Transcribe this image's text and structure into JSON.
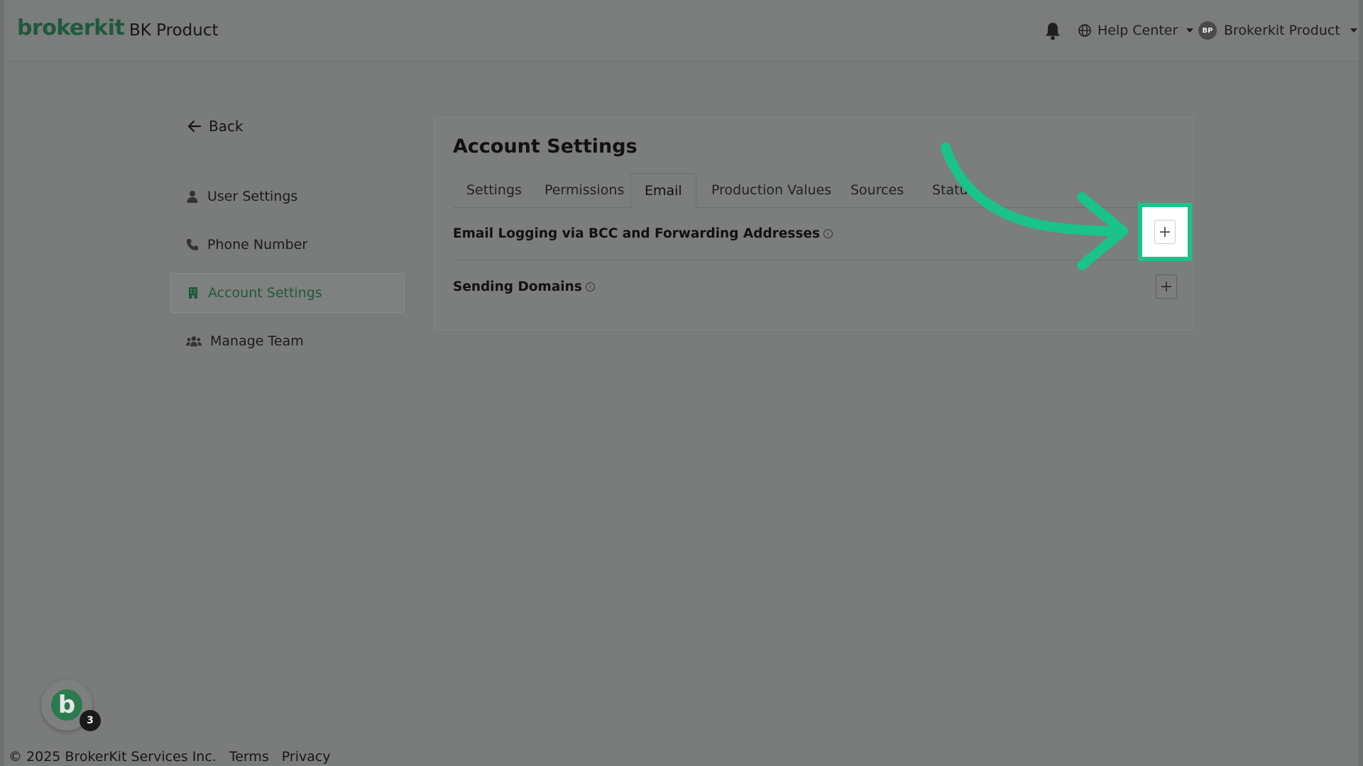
{
  "header": {
    "logo": "brokerkit",
    "product_name": "BK Product",
    "help_center": "Help Center",
    "user_initials": "BP",
    "user_name": "Brokerkit Product"
  },
  "sidebar": {
    "back_label": "Back",
    "items": [
      {
        "label": "User Settings",
        "icon": "user-icon"
      },
      {
        "label": "Phone Number",
        "icon": "phone-icon"
      },
      {
        "label": "Account Settings",
        "icon": "building-icon",
        "active": true
      },
      {
        "label": "Manage Team",
        "icon": "users-icon"
      }
    ]
  },
  "main": {
    "title": "Account Settings",
    "tabs": [
      {
        "label": "Settings"
      },
      {
        "label": "Permissions"
      },
      {
        "label": "Email",
        "active": true
      },
      {
        "label": "Production Values"
      },
      {
        "label": "Sources"
      },
      {
        "label": "Status"
      }
    ],
    "sections": [
      {
        "label": "Email Logging via BCC and Forwarding Addresses",
        "info": "i",
        "action": "+"
      },
      {
        "label": "Sending Domains",
        "info": "i",
        "action": "+"
      }
    ]
  },
  "widget": {
    "letter": "b",
    "badge_count": "3"
  },
  "footer": {
    "copyright": "© 2025 BrokerKit Services Inc.",
    "terms": "Terms",
    "privacy": "Privacy"
  },
  "colors": {
    "brand_green": "#1e5a3c",
    "highlight_green": "#19c38a",
    "overlay_gray": "#7a7b7b"
  }
}
